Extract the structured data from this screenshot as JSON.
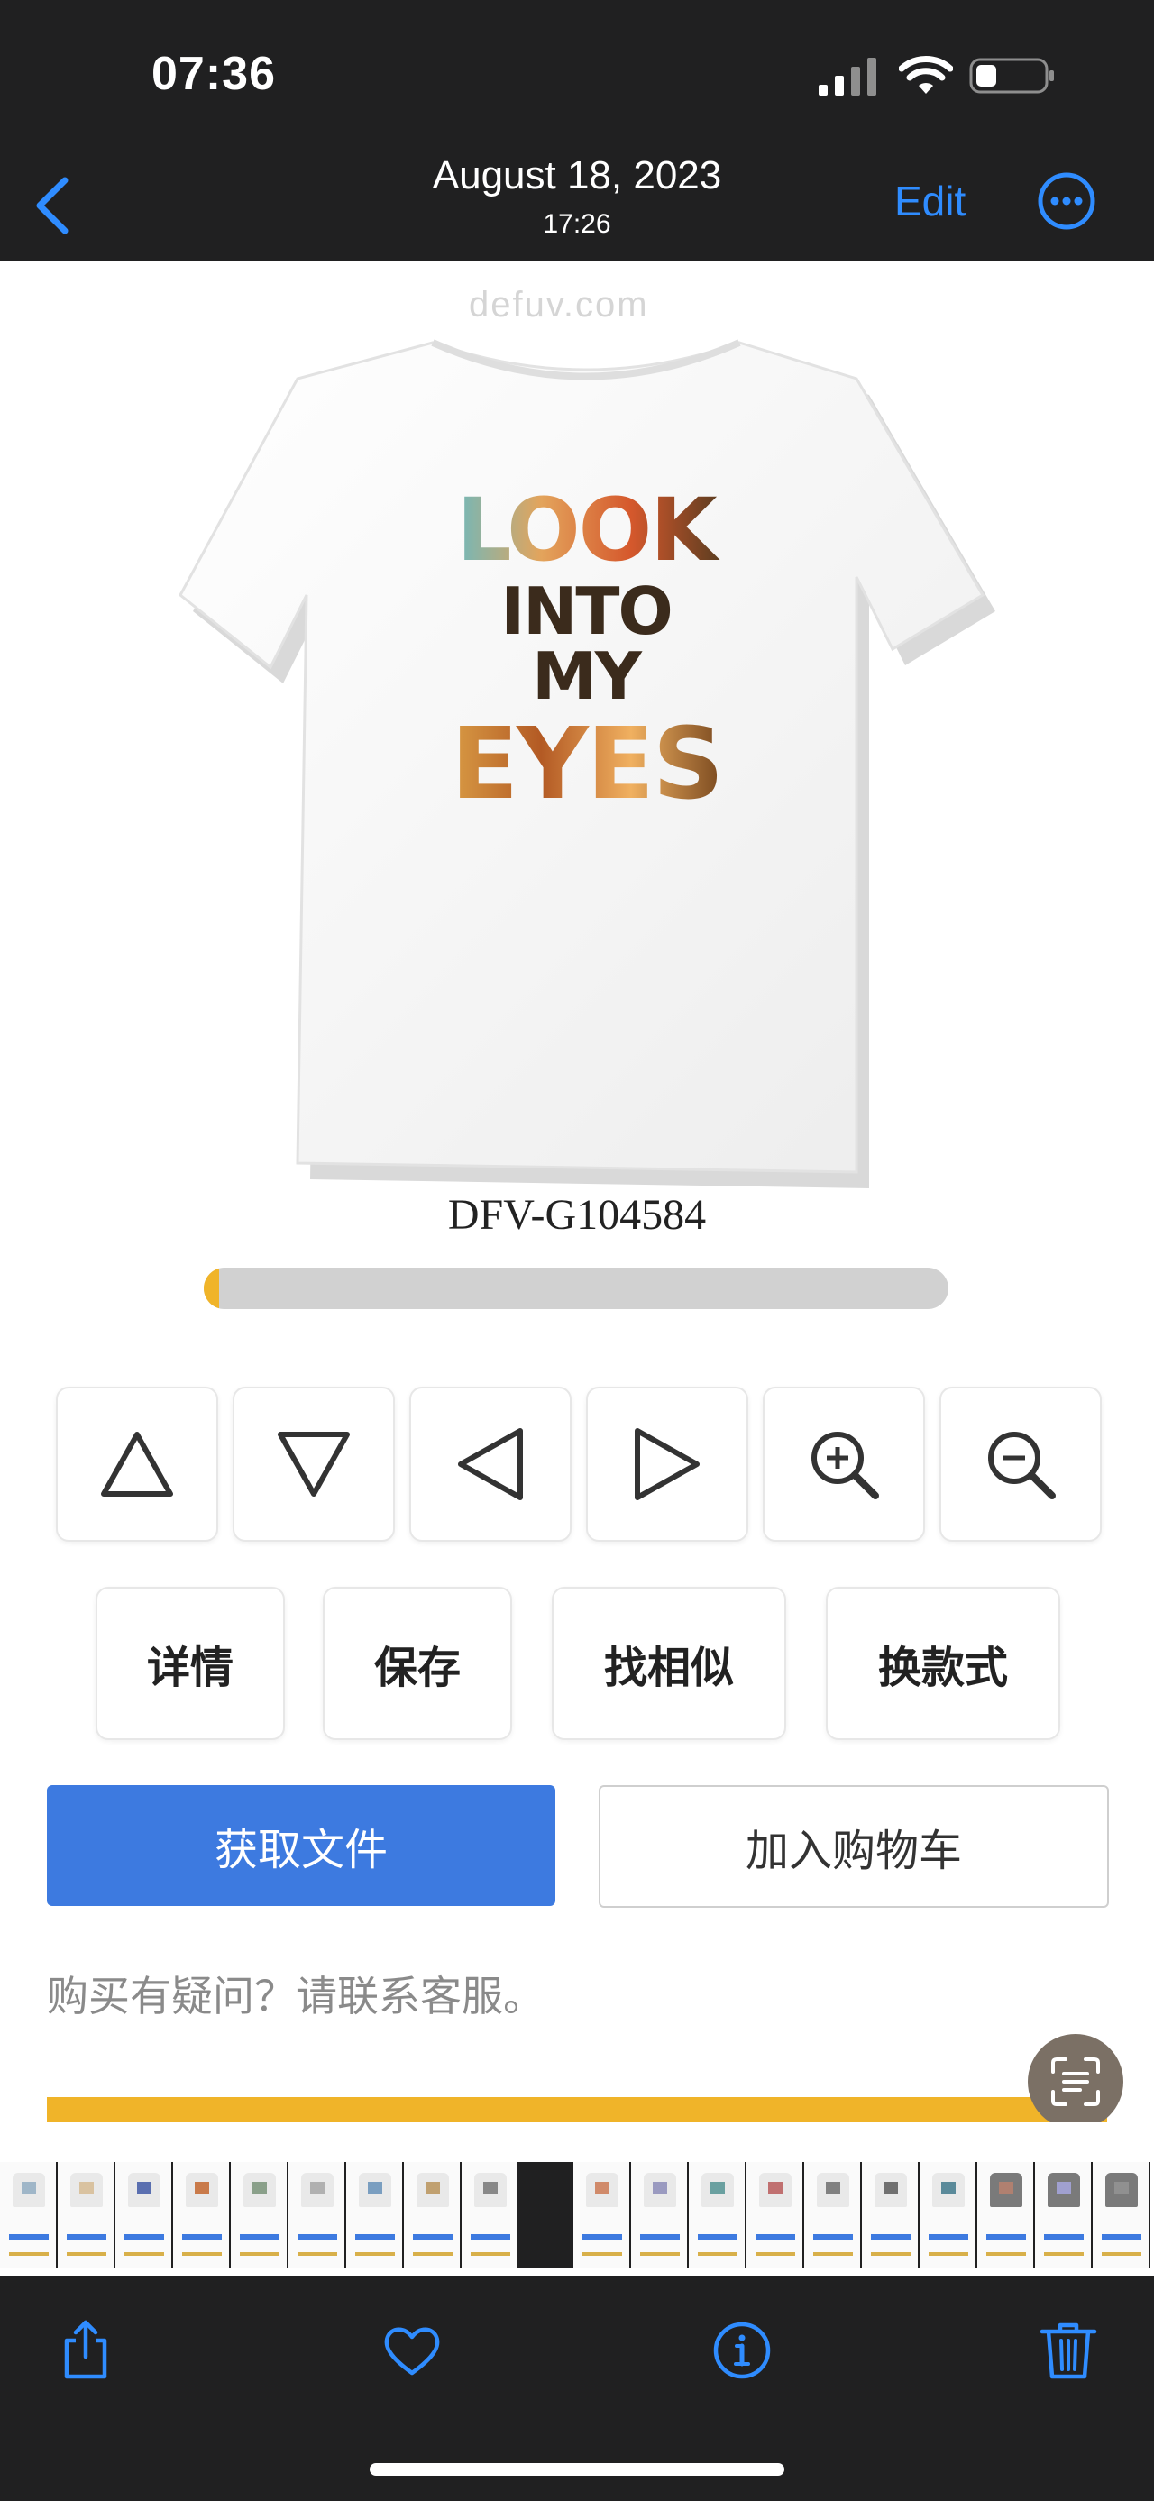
{
  "status_bar": {
    "time": "07:36"
  },
  "nav": {
    "date": "August 18, 2023",
    "time": "17:26",
    "edit_label": "Edit"
  },
  "photo": {
    "watermark": "defuv.com",
    "shirt_text": [
      "LOOK",
      "INTO MY",
      "EYES"
    ],
    "product_code": "DFV-G104584",
    "progress": 0.02
  },
  "controls": {
    "up": "triangle-up-icon",
    "down": "triangle-down-icon",
    "left": "triangle-left-icon",
    "right": "triangle-right-icon",
    "zoom_in": "zoom-in-icon",
    "zoom_out": "zoom-out-icon"
  },
  "actions": {
    "details": "详情",
    "save": "保存",
    "similar": "找相似",
    "change_style": "换款式"
  },
  "buttons": {
    "get_file": "获取文件",
    "add_to_cart": "加入购物车"
  },
  "help_text": "购买有疑问？请联系客服。",
  "colors": {
    "accent_blue": "#3d7ae0",
    "ios_blue": "#2f8cff",
    "progress_yellow": "#f0b429"
  }
}
